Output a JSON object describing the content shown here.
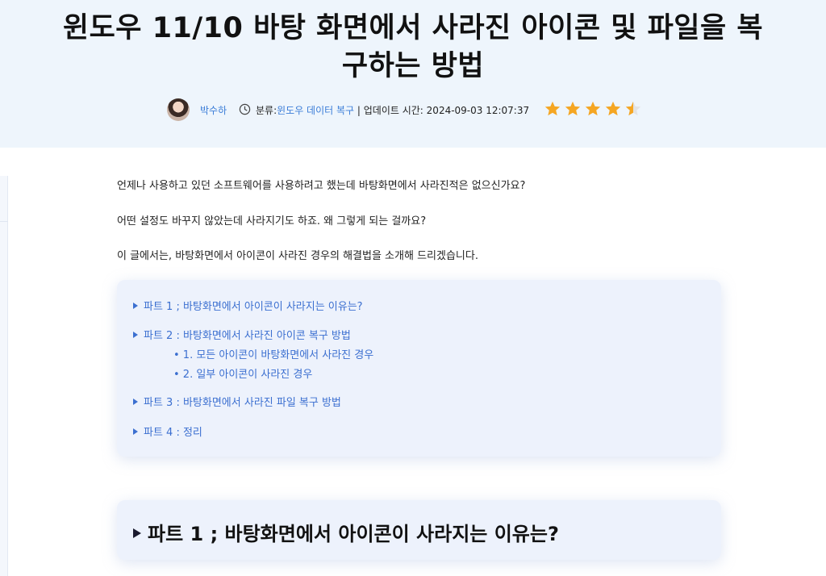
{
  "article": {
    "title_line1": "윈도우 11/10 바탕 화면에서 사라진 아이콘 및 파일을 복",
    "title_line2": "구하는 방법",
    "author": "박수하",
    "category_label": "분류:",
    "category": "윈도우 데이터 복구",
    "update_label": " | 업데이트 시간: ",
    "updated": "2024-09-03 12:07:37",
    "rating": 4.5
  },
  "intro": [
    "언제나 사용하고 있던 소프트웨어를 사용하려고 했는데 바탕화면에서 사라진적은 없으신가요?",
    "어떤 설정도 바꾸지 않았는데 사라지기도 하죠. 왜 그렇게 되는 걸까요?",
    "이 글에서는, 바탕화면에서 아이콘이 사라진 경우의 해결법을 소개해 드리겠습니다."
  ],
  "toc": {
    "items": [
      "파트 1 ; 바탕화면에서 아이콘이 사라지는 이유는?",
      "파트 2 : 바탕화면에서 사라진 아이콘 복구 방법",
      "파트 3 : 바탕화면에서 사라진 파일 복구 방법",
      "파트 4 : 정리"
    ],
    "subitems": [
      "• 1. 모든 아이콘이 바탕화면에서 사라진 경우",
      "• 2. 일부 아이콘이 사라진 경우"
    ]
  },
  "section1": {
    "heading": "파트 1 ; 바탕화면에서 아이콘이 사라지는 이유는?"
  },
  "colors": {
    "accent": "#3b6fd0",
    "star": "#f5a623",
    "hero_bg": "#eef5fc"
  },
  "icons": {
    "clock": "clock-icon",
    "star": "star-icon",
    "triangle": "triangle-right-icon"
  }
}
